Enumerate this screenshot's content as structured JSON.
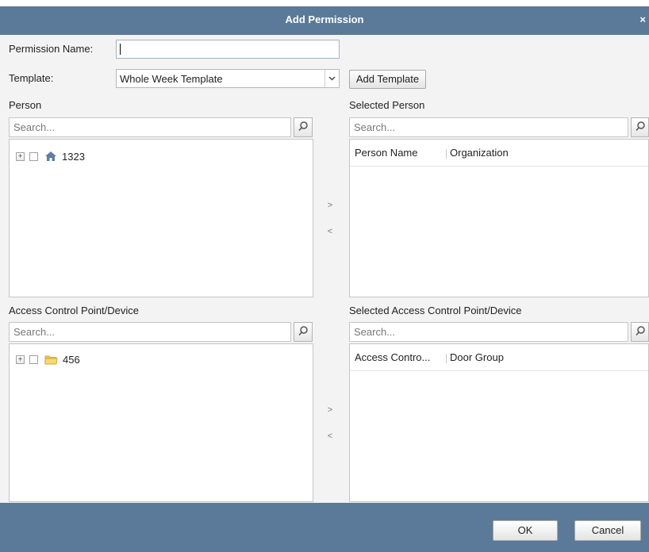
{
  "dialog": {
    "title": "Add Permission",
    "close_glyph": "×"
  },
  "fields": {
    "permission_name_label": "Permission Name:",
    "permission_name_value": "",
    "template_label": "Template:",
    "template_value": "Whole Week Template",
    "add_template_label": "Add Template"
  },
  "person": {
    "title": "Person",
    "search_placeholder": "Search...",
    "tree": [
      {
        "label": "1323",
        "icon": "home-icon"
      }
    ]
  },
  "selected_person": {
    "title": "Selected Person",
    "search_placeholder": "Search...",
    "columns": [
      "Person Name",
      "Organization"
    ]
  },
  "device": {
    "title": "Access Control Point/Device",
    "search_placeholder": "Search...",
    "tree": [
      {
        "label": "456",
        "icon": "folder-icon"
      }
    ]
  },
  "selected_device": {
    "title": "Selected Access Control Point/Device",
    "search_placeholder": "Search...",
    "columns": [
      "Access Contro...",
      "Door Group"
    ]
  },
  "transfer": {
    "add": ">",
    "remove": "<"
  },
  "footer": {
    "ok_label": "OK",
    "cancel_label": "Cancel"
  },
  "colors": {
    "titlebar": "#5b7a99",
    "footer": "#5b7a99",
    "content_bg": "#f3f3f3"
  }
}
